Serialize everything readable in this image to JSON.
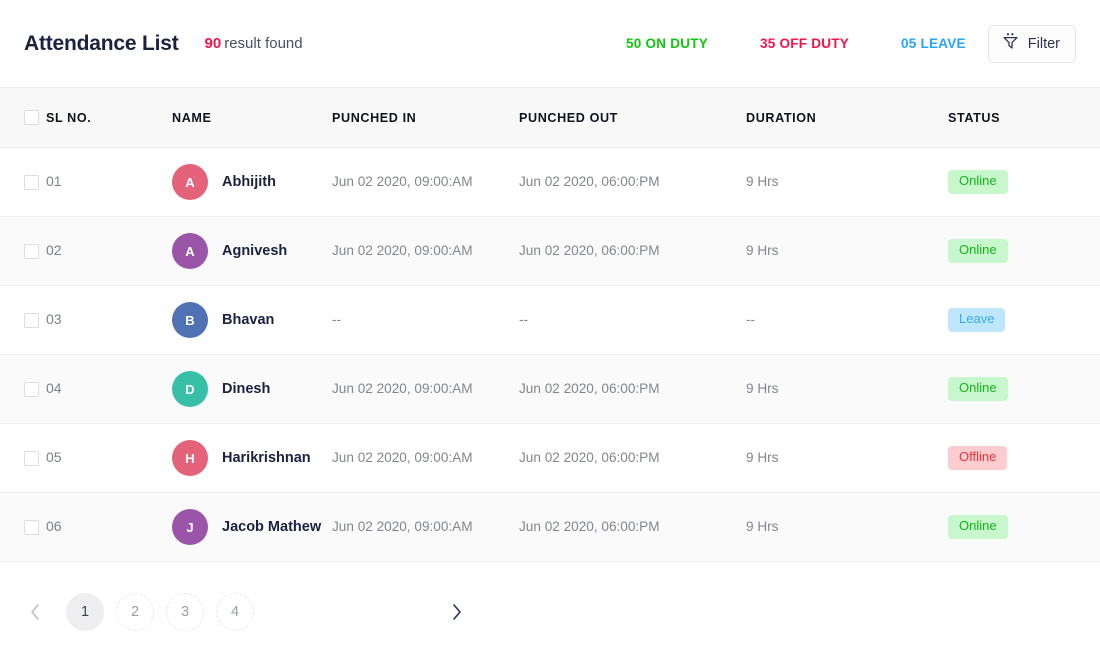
{
  "header": {
    "title": "Attendance List",
    "result_count": "90",
    "result_label": "result found",
    "stats": {
      "on_duty": "50 ON DUTY",
      "off_duty": "35 OFF DUTY",
      "leave": "05 LEAVE"
    },
    "filter_label": "Filter",
    "colors": {
      "on_duty": "#0fc70f",
      "off_duty": "#f5134a",
      "leave": "#26a4f8",
      "result_count": "#f5134a",
      "title": "#1b2240"
    }
  },
  "table": {
    "columns": [
      {
        "key": "sl_no",
        "label": "SL NO."
      },
      {
        "key": "name",
        "label": "NAME"
      },
      {
        "key": "punched_in",
        "label": "PUNCHED IN"
      },
      {
        "key": "punched_out",
        "label": "PUNCHED OUT"
      },
      {
        "key": "duration",
        "label": "DURATION"
      },
      {
        "key": "status",
        "label": "STATUS"
      }
    ],
    "rows": [
      {
        "sl_no": "01",
        "initial": "A",
        "avatar_color": "#e4637a",
        "name": "Abhijith",
        "punched_in": "Jun 02 2020, 09:00:AM",
        "punched_out": "Jun 02 2020, 06:00:PM",
        "duration": "9 Hrs",
        "status": "Online",
        "status_kind": "online"
      },
      {
        "sl_no": "02",
        "initial": "A",
        "avatar_color": "#9a55a8",
        "name": "Agnivesh",
        "punched_in": "Jun 02 2020, 09:00:AM",
        "punched_out": "Jun 02 2020, 06:00:PM",
        "duration": "9 Hrs",
        "status": "Online",
        "status_kind": "online"
      },
      {
        "sl_no": "03",
        "initial": "B",
        "avatar_color": "#5072b4",
        "name": "Bhavan",
        "punched_in": "--",
        "punched_out": "--",
        "duration": "--",
        "status": "Leave",
        "status_kind": "leave"
      },
      {
        "sl_no": "04",
        "initial": "D",
        "avatar_color": "#38bfa8",
        "name": "Dinesh",
        "punched_in": "Jun 02 2020, 09:00:AM",
        "punched_out": "Jun 02 2020, 06:00:PM",
        "duration": "9 Hrs",
        "status": "Online",
        "status_kind": "online"
      },
      {
        "sl_no": "05",
        "initial": "H",
        "avatar_color": "#e4637a",
        "name": "Harikrishnan",
        "punched_in": "Jun 02 2020, 09:00:AM",
        "punched_out": "Jun 02 2020, 06:00:PM",
        "duration": "9 Hrs",
        "status": "Offline",
        "status_kind": "offline"
      },
      {
        "sl_no": "06",
        "initial": "J",
        "avatar_color": "#9a55a8",
        "name": "Jacob Mathew",
        "punched_in": "Jun 02 2020, 09:00:AM",
        "punched_out": "Jun 02 2020, 06:00:PM",
        "duration": "9 Hrs",
        "status": "Online",
        "status_kind": "online"
      }
    ]
  },
  "pagination": {
    "pages": [
      "1",
      "2",
      "3",
      "4"
    ],
    "active_page": "1"
  }
}
